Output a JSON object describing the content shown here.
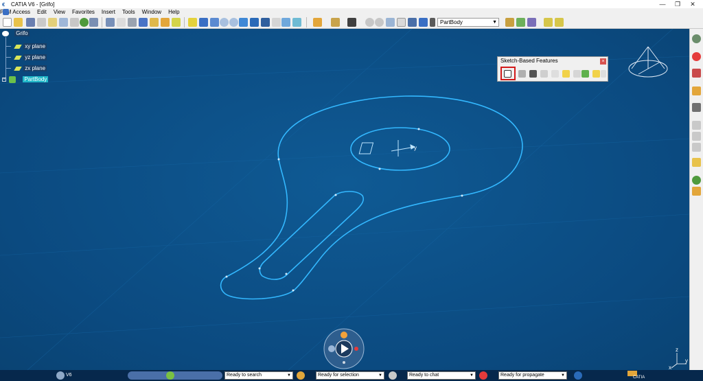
{
  "window": {
    "title": "CATIA V6 - [Grifo]",
    "app_icon": "catia-icon",
    "controls": [
      "—",
      "❐",
      "✕"
    ]
  },
  "menu": [
    "PLM Access",
    "Edit",
    "View",
    "Favorites",
    "Insert",
    "Tools",
    "Window",
    "Help"
  ],
  "toolbar": {
    "body_selector": "PartBody"
  },
  "tree": {
    "root": "Grifo",
    "items": [
      "xy plane",
      "yz plane",
      "zx plane",
      "PartBody"
    ]
  },
  "sketch_toolbar": {
    "title": "Sketch-Based Features",
    "close": "×"
  },
  "status": {
    "brand_v6": "V6",
    "search": "Ready to search",
    "selection": "Ready for selection",
    "chat": "Ready to chat",
    "propagate": "Ready for propagate",
    "brand_catia": "CATIA"
  },
  "axis_triad": {
    "x": "x",
    "y": "y",
    "z": "z"
  },
  "colors": {
    "viewport_bg": "#0b4a80",
    "sketch_line": "#33b8ff",
    "selection_highlight": "#1fb7c8",
    "highlight_box": "#d21a1a"
  }
}
